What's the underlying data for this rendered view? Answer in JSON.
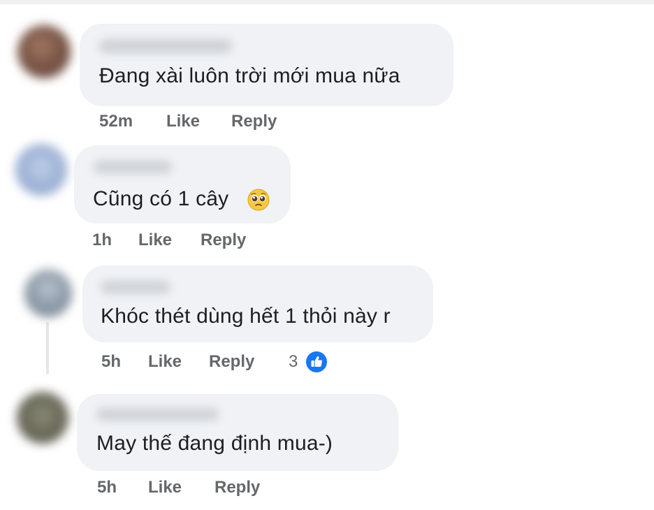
{
  "comments": [
    {
      "author": "",
      "text": "Đang xài luôn trời mới mua nữa",
      "time": "52m",
      "like_label": "Like",
      "reply_label": "Reply"
    },
    {
      "author": "",
      "text": "Cũng có 1 cây",
      "emoji": "pleading-face-icon",
      "time": "1h",
      "like_label": "Like",
      "reply_label": "Reply"
    },
    {
      "author": "",
      "text": "Khóc thét dùng hết 1 thỏi này r",
      "time": "5h",
      "like_label": "Like",
      "reply_label": "Reply",
      "reaction_count": "3",
      "reaction_icon": "thumbs-up-icon"
    },
    {
      "author": "",
      "text": "May thế đang định mua-)",
      "time": "5h",
      "like_label": "Like",
      "reply_label": "Reply"
    }
  ],
  "colors": {
    "bubble": "#f0f2f5",
    "meta": "#65676b",
    "text": "#1c1e21",
    "like_badge": "#1877f2"
  }
}
